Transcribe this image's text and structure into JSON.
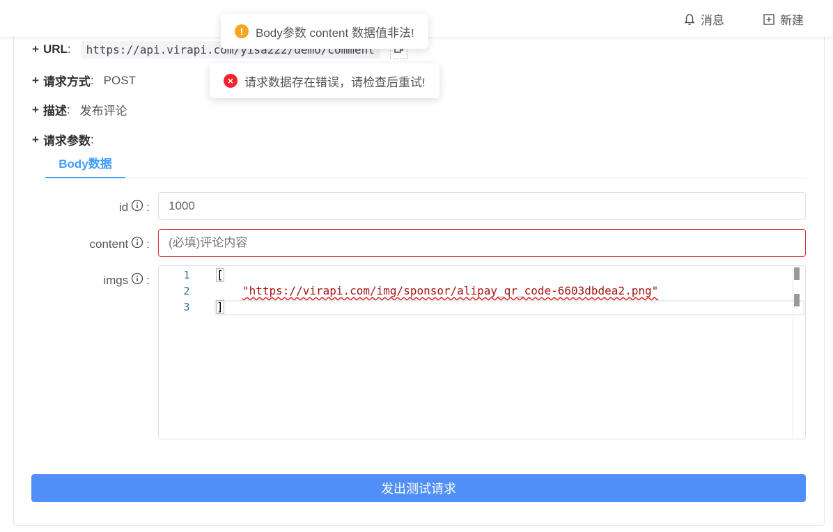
{
  "header": {
    "messages_label": "消息",
    "new_label": "新建",
    "bell_icon": "bell-icon",
    "plus_square_icon": "plus-square-icon"
  },
  "api": {
    "url_label": "URL",
    "url_value": "https://api.virapi.com/yisa222/demo/comment",
    "method_label": "请求方式",
    "method_value": "POST",
    "desc_label": "描述",
    "desc_value": "发布评论",
    "params_label": "请求参数",
    "prefix": "+",
    "colon": ":"
  },
  "tabs": [
    {
      "label": "Body数据",
      "active": true
    }
  ],
  "form": {
    "id": {
      "label": "id",
      "value": "1000"
    },
    "content": {
      "label": "content",
      "placeholder": "(必填)评论内容",
      "value": "",
      "error": true
    },
    "imgs": {
      "label": "imgs",
      "line_numbers": [
        "1",
        "2",
        "3"
      ],
      "lines": [
        "[",
        "\"https://virapi.com/img/sponsor/alipay_qr_code-6603dbdea2.png\"",
        "]"
      ]
    }
  },
  "submit_label": "发出测试请求",
  "toasts": [
    {
      "type": "warning",
      "text": "Body参数 content 数据值非法!",
      "icon": "!"
    },
    {
      "type": "error",
      "text": "请求数据存在错误，请检查后重试!",
      "icon": "×"
    }
  ],
  "colors": {
    "primary": "#409eff",
    "button": "#4f8ff7",
    "warning": "#f5a623",
    "error": "#f5222d",
    "invalid_border": "#d9363e"
  }
}
